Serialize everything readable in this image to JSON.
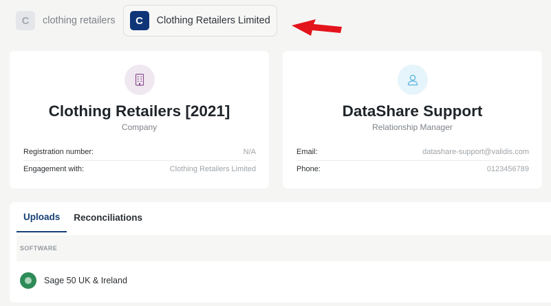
{
  "switcher": {
    "inactive": {
      "initial": "C",
      "name": "clothing retailers"
    },
    "active": {
      "initial": "C",
      "name": "Clothing Retailers Limited"
    }
  },
  "company_card": {
    "title": "Clothing Retailers [2021]",
    "subtitle": "Company",
    "rows": [
      {
        "label": "Registration number:",
        "value": "N/A"
      },
      {
        "label": "Engagement with:",
        "value": "Clothing Retailers Limited"
      }
    ]
  },
  "manager_card": {
    "title": "DataShare Support",
    "subtitle": "Relationship Manager",
    "rows": [
      {
        "label": "Email:",
        "value": "datashare-support@validis.com"
      },
      {
        "label": "Phone:",
        "value": "0123456789"
      }
    ]
  },
  "tabs": [
    {
      "label": "Uploads",
      "active": true
    },
    {
      "label": "Reconciliations",
      "active": false
    }
  ],
  "table": {
    "column": "SOFTWARE",
    "rows": [
      {
        "software": "Sage 50 UK & Ireland",
        "status": "connected"
      }
    ]
  },
  "colors": {
    "active_badge": "#0f3578",
    "tab_active": "#153f74",
    "status_green": "#2e8b57",
    "arrow": "#e3141b"
  },
  "icons": {
    "company": "building-icon",
    "manager": "user-icon",
    "annotation": "red-arrow-icon"
  }
}
